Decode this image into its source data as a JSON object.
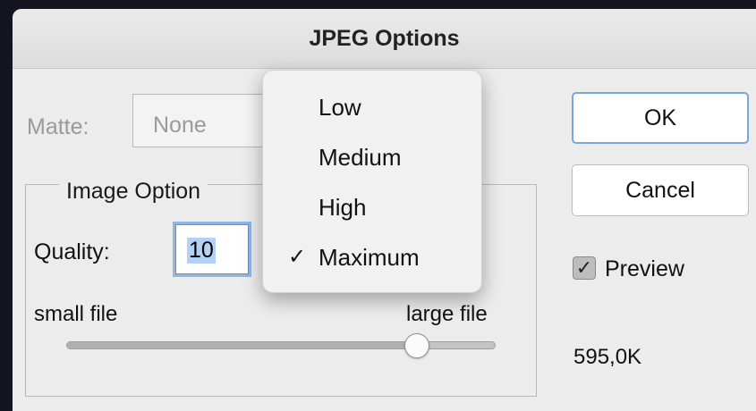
{
  "dialog": {
    "title": "JPEG Options"
  },
  "matte": {
    "label": "Matte:",
    "value": "None"
  },
  "image_options": {
    "title": "Image Option",
    "quality_label": "Quality:",
    "quality_value": "10",
    "quality_options": [
      "Low",
      "Medium",
      "High",
      "Maximum"
    ],
    "quality_selected": "Maximum",
    "check_mark": "✓",
    "slider": {
      "small_label": "small file",
      "large_label": "large file",
      "min": 0,
      "max": 12,
      "value": 10
    }
  },
  "buttons": {
    "ok": "OK",
    "cancel": "Cancel"
  },
  "preview": {
    "label": "Preview",
    "checked": true,
    "checkmark": "✓"
  },
  "file_size": "595,0K",
  "colors": {
    "accent": "#78a4e0",
    "selection": "#b3d0f5"
  }
}
